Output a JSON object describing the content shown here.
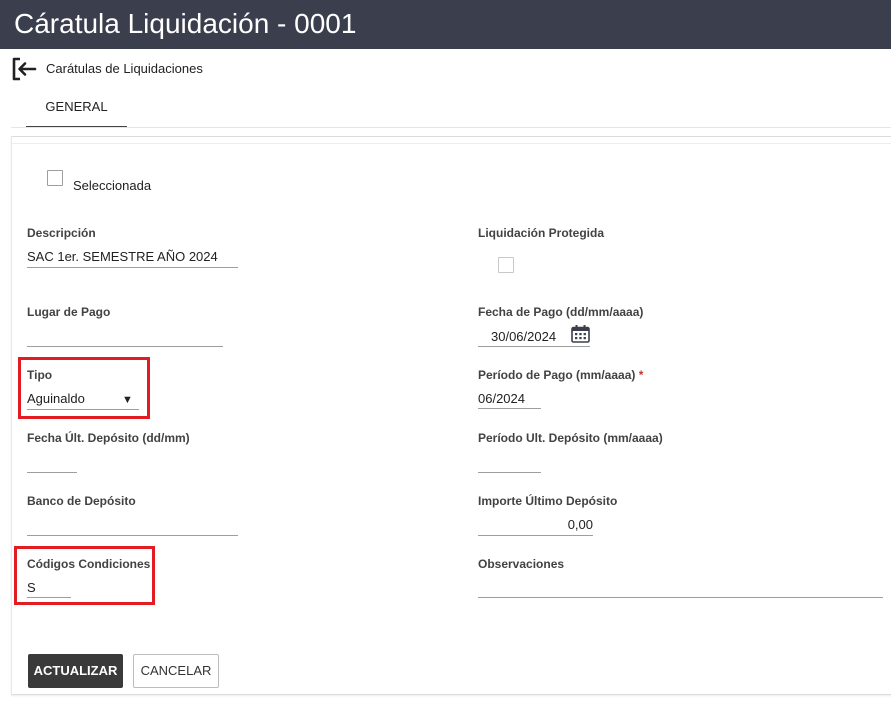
{
  "window": {
    "title": "Cáratula Liquidación - 0001"
  },
  "breadcrumb": {
    "label": "Carátulas de Liquidaciones"
  },
  "tabs": [
    {
      "label": "GENERAL",
      "active": true
    }
  ],
  "form": {
    "seleccionada": {
      "label": "Seleccionada",
      "checked": false
    },
    "descripcion": {
      "label": "Descripción",
      "value": "SAC 1er. SEMESTRE AÑO 2024"
    },
    "liquidacion_protegida": {
      "label": "Liquidación Protegida",
      "checked": false
    },
    "lugar_pago": {
      "label": "Lugar de Pago",
      "value": ""
    },
    "fecha_pago": {
      "label": "Fecha de Pago (dd/mm/aaaa)",
      "value": "30/06/2024"
    },
    "tipo": {
      "label": "Tipo",
      "value": "Aguinaldo"
    },
    "periodo_pago": {
      "label": "Período de Pago (mm/aaaa)",
      "required_mark": "*",
      "value": "06/2024"
    },
    "fecha_ult_deposito": {
      "label": "Fecha Últ. Depósito (dd/mm)",
      "value": ""
    },
    "periodo_ult_deposito": {
      "label": "Período Ult. Depósito (mm/aaaa)",
      "value": ""
    },
    "banco_deposito": {
      "label": "Banco de Depósito",
      "value": ""
    },
    "importe_ultimo_deposito": {
      "label": "Importe Último Depósito",
      "value": "0,00"
    },
    "codigos_condiciones": {
      "label": "Códigos Condiciones",
      "value": "S"
    },
    "observaciones": {
      "label": "Observaciones",
      "value": ""
    }
  },
  "buttons": {
    "update": "ACTUALIZAR",
    "cancel": "CANCELAR"
  },
  "colors": {
    "titlebar": "#3b3f4d",
    "highlight": "#e31b23",
    "primary_button": "#3a3a3a",
    "required": "#d32f2f"
  },
  "icons": {
    "back": "arrow-left-bracket-icon",
    "calendar": "calendar-icon",
    "dropdown": "caret-down-icon"
  }
}
